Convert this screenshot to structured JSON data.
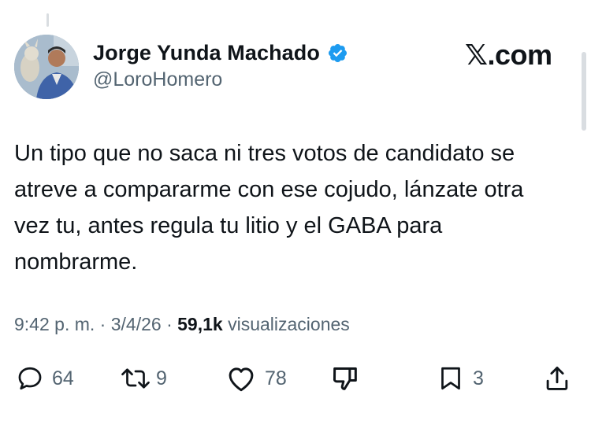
{
  "author": {
    "name": "Jorge Yunda Machado",
    "handle": "@LoroHomero",
    "verified": true
  },
  "brand": {
    "logo_text": "𝕏.com"
  },
  "tweet": {
    "lines": [
      "Un tipo que no saca ni tres votos de candidato se",
      "atreve a compararme con ese cojudo, lánzate otra",
      "vez tu, antes regula tu litio y el GABA para",
      "nombrarme."
    ]
  },
  "meta": {
    "time": "9:42 p. m.",
    "sep1": "·",
    "date": "3/4/26",
    "sep2": "·",
    "views": "59,1k",
    "views_label": "visualizaciones"
  },
  "actions": {
    "replies": "64",
    "reposts": "9",
    "likes": "78",
    "bookmarks": "3"
  },
  "colors": {
    "text": "#0f1419",
    "secondary": "#536471",
    "verified_badge": "#1d9bf0"
  },
  "icons": [
    "reply-icon",
    "repost-icon",
    "like-icon",
    "dislike-icon",
    "bookmark-icon",
    "share-icon",
    "verified-badge-icon"
  ]
}
